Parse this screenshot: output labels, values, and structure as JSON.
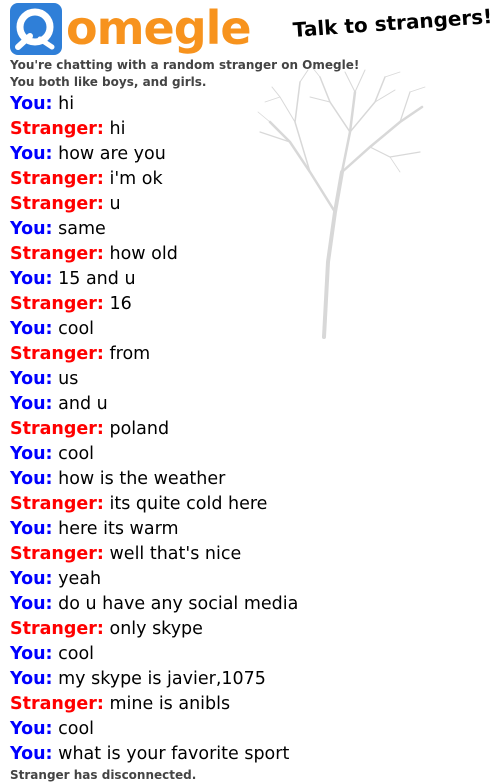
{
  "header": {
    "logo_text": "omegle",
    "tagline": "Talk to strangers!",
    "logo_color": "#f7931e",
    "logo_icon_color": "#2f7fd8"
  },
  "status": {
    "line1": "You're chatting with a random stranger on Omegle!",
    "line2": "You both like boys, and girls.",
    "disconnected": "Stranger has disconnected."
  },
  "colors": {
    "you": "#0000ff",
    "stranger": "#ff0000"
  },
  "messages": [
    {
      "who": "You:",
      "text": "hi"
    },
    {
      "who": "Stranger:",
      "text": "hi"
    },
    {
      "who": "You:",
      "text": "how are you"
    },
    {
      "who": "Stranger:",
      "text": "i'm ok"
    },
    {
      "who": "Stranger:",
      "text": "u"
    },
    {
      "who": "You:",
      "text": "same"
    },
    {
      "who": "Stranger:",
      "text": "how old"
    },
    {
      "who": "You:",
      "text": "15 and u"
    },
    {
      "who": "Stranger:",
      "text": "16"
    },
    {
      "who": "You:",
      "text": "cool"
    },
    {
      "who": "Stranger:",
      "text": "from"
    },
    {
      "who": "You:",
      "text": "us"
    },
    {
      "who": "You:",
      "text": "and u"
    },
    {
      "who": "Stranger:",
      "text": "poland"
    },
    {
      "who": "You:",
      "text": "cool"
    },
    {
      "who": "You:",
      "text": "how is the weather"
    },
    {
      "who": "Stranger:",
      "text": "its quite cold here"
    },
    {
      "who": "You:",
      "text": "here its warm"
    },
    {
      "who": "Stranger:",
      "text": "well that's nice"
    },
    {
      "who": "You:",
      "text": "yeah"
    },
    {
      "who": "You:",
      "text": "do u have any social media"
    },
    {
      "who": "Stranger:",
      "text": "only skype"
    },
    {
      "who": "You:",
      "text": "cool"
    },
    {
      "who": "You:",
      "text": "my skype is javier,1075"
    },
    {
      "who": "Stranger:",
      "text": "mine is anibls"
    },
    {
      "who": "You:",
      "text": "cool"
    },
    {
      "who": "You:",
      "text": "what is your favorite sport"
    }
  ]
}
